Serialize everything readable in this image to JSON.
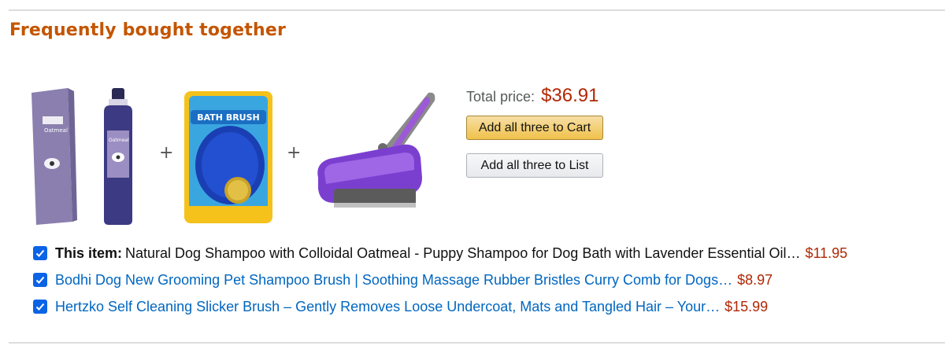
{
  "section": {
    "title": "Frequently bought together"
  },
  "summary": {
    "total_label": "Total price:",
    "total_value": "$36.91",
    "add_cart_label": "Add all three to Cart",
    "add_list_label": "Add all three to List"
  },
  "items": [
    {
      "prefix": "This item:",
      "title": "Natural Dog Shampoo with Colloidal Oatmeal - Puppy Shampoo for Dog Bath with Lavender Essential Oil…",
      "price": "$11.95",
      "checked": true
    },
    {
      "title": "Bodhi Dog New Grooming Pet Shampoo Brush | Soothing Massage Rubber Bristles Curry Comb for Dogs…",
      "price": "$8.97",
      "checked": true
    },
    {
      "title": "Hertzko Self Cleaning Slicker Brush – Gently Removes Loose Undercoat, Mats and Tangled Hair – Your…",
      "price": "$15.99",
      "checked": true
    }
  ],
  "image_labels": {
    "shampoo_box_1": "Oatmeal",
    "shampoo_bottle_1": "Oatmeal",
    "brush_package": "BATH BRUSH"
  },
  "separator": "+",
  "colors": {
    "heading": "#c45500",
    "price": "#b12704",
    "link": "#0066c0",
    "checkbox": "#0b63e5"
  }
}
